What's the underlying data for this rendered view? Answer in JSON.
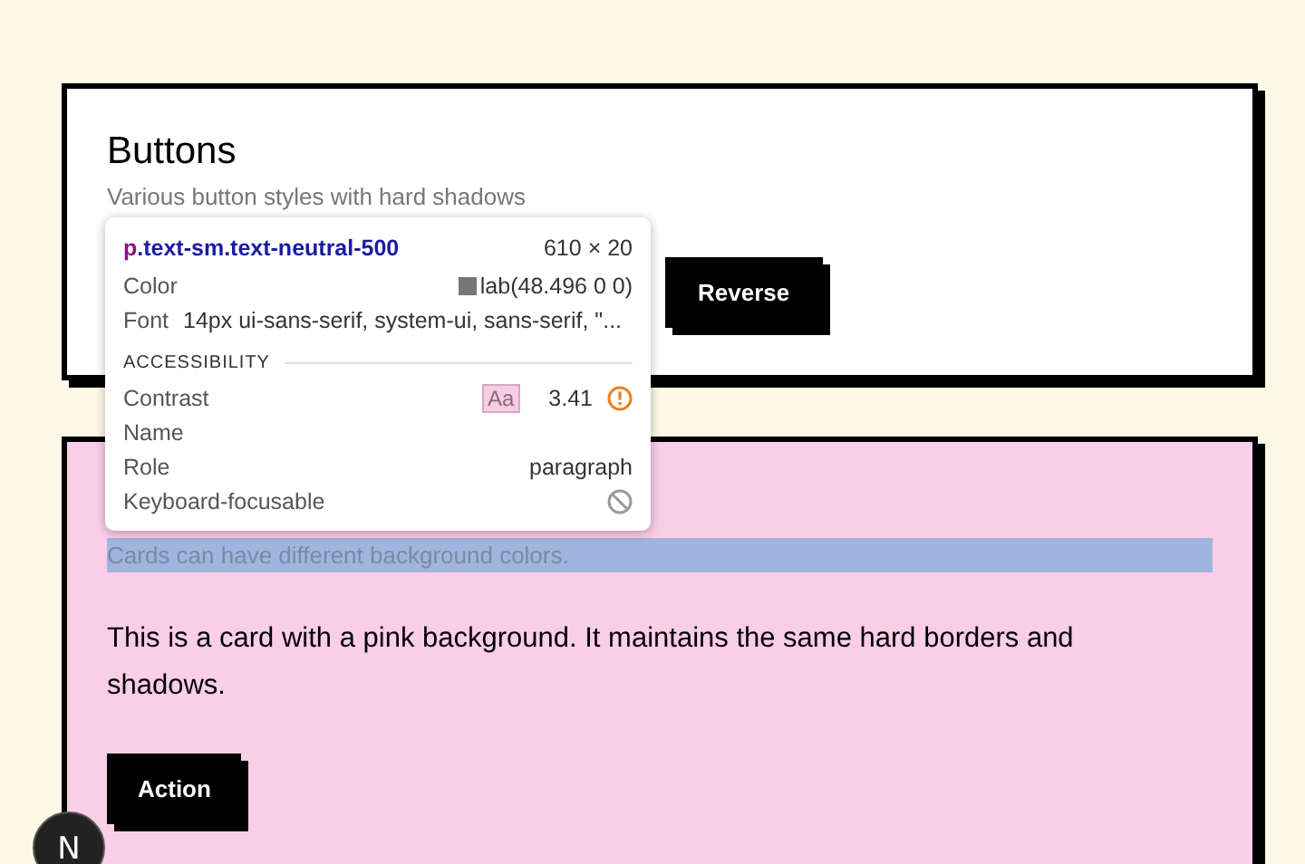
{
  "cards": [
    {
      "kind": "plain",
      "title": "Buttons",
      "subtitle": "Various button styles with hard shadows",
      "buttons": [
        "Reverse"
      ]
    },
    {
      "kind": "pink",
      "subtitle": "Cards can have different background colors.",
      "subtitle_highlighted": true,
      "body": "This is a card with a pink background. It maintains the same hard borders and shadows.",
      "buttons": [
        "Action"
      ]
    }
  ],
  "inspector": {
    "tag": "p",
    "classes": ".text-sm.text-neutral-500",
    "size": "610 × 20",
    "rows": [
      {
        "kind": "color",
        "label": "Color",
        "value": "lab(48.496 0 0)",
        "color": "#767676"
      },
      {
        "kind": "text",
        "label": "Font",
        "value": "14px ui-sans-serif, system-ui, sans-serif, \"..."
      }
    ],
    "section": "ACCESSIBILITY",
    "a11y": [
      {
        "kind": "contrast",
        "label": "Contrast",
        "badge": "Aa",
        "value": "3.41"
      },
      {
        "kind": "text",
        "label": "Name"
      },
      {
        "kind": "text",
        "label": "Role",
        "value": "paragraph"
      },
      {
        "kind": "blocked",
        "label": "Keyboard-focusable"
      }
    ]
  },
  "badge": {
    "letter": "N"
  }
}
